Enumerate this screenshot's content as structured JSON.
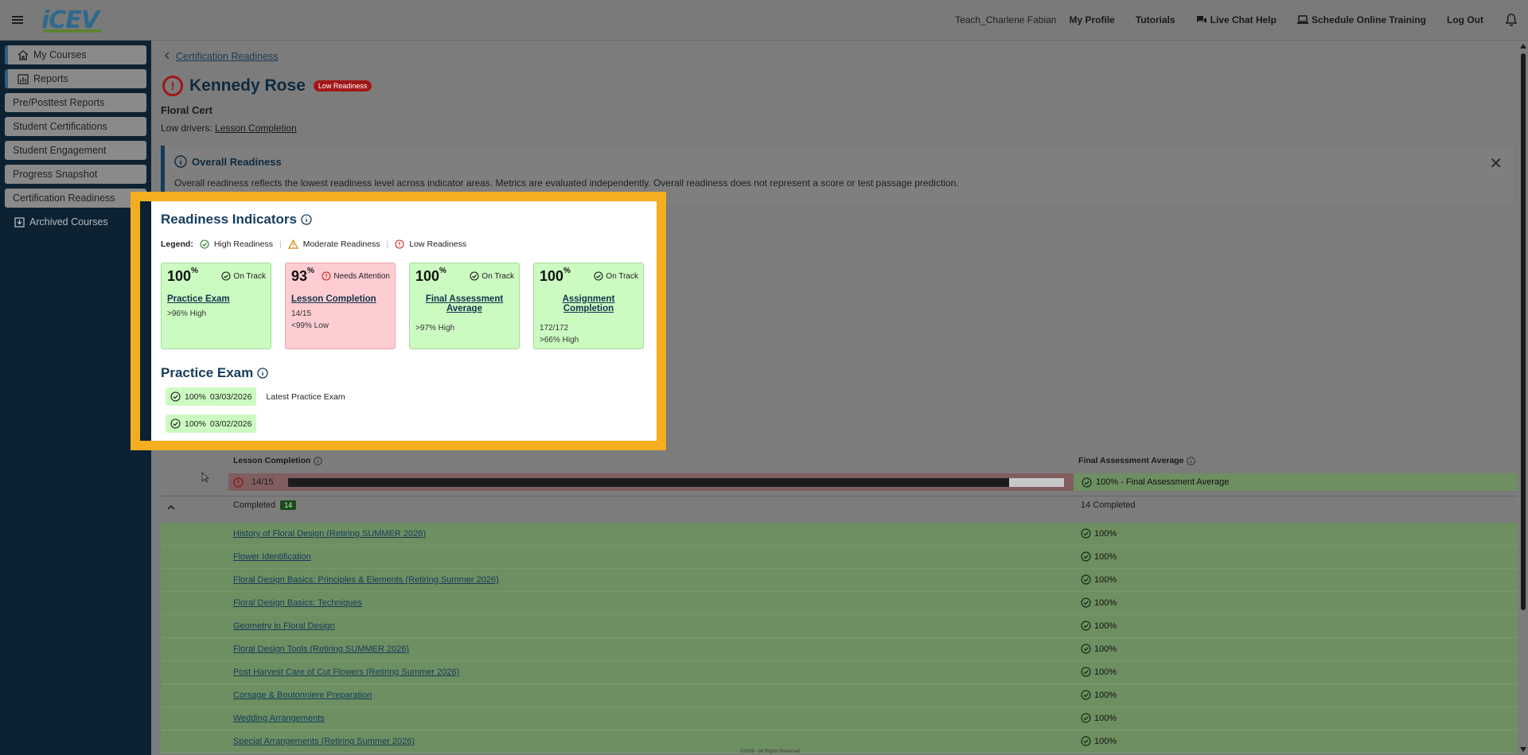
{
  "header": {
    "logo": "iCEV",
    "user": "Teach_Charlene Fabian",
    "links": [
      "My Profile",
      "Tutorials",
      "Live Chat Help",
      "Schedule Online Training",
      "Log Out"
    ]
  },
  "sidebar": {
    "items": [
      {
        "label": "My Courses",
        "icon": "home-icon"
      },
      {
        "label": "Reports",
        "icon": "chart-icon"
      },
      {
        "label": "Pre/Posttest Reports"
      },
      {
        "label": "Student Certifications"
      },
      {
        "label": "Student Engagement"
      },
      {
        "label": "Progress Snapshot"
      },
      {
        "label": "Certification Readiness"
      },
      {
        "label": "Archived Courses",
        "icon": "archive-icon"
      }
    ]
  },
  "breadcrumb": {
    "label": "Certification Readiness"
  },
  "student": {
    "name": "Kennedy Rose",
    "badge": "Low Readiness",
    "cert": "Floral Cert",
    "low_drivers_label": "Low drivers:",
    "low_drivers_value": "Lesson Completion"
  },
  "overall": {
    "title": "Overall Readiness",
    "text": "Overall readiness reflects the lowest readiness level across indicator areas. Metrics are evaluated independently. Overall readiness does not represent a score or test passage prediction."
  },
  "indicators": {
    "title": "Readiness Indicators",
    "legend_label": "Legend:",
    "legend": [
      "High Readiness",
      "Moderate Readiness",
      "Low Readiness"
    ],
    "cards": [
      {
        "pct": "100",
        "sym": "%",
        "status": "On Track",
        "name": "Practice Exam",
        "meta1": ">96% High",
        "meta2": ""
      },
      {
        "pct": "93",
        "sym": "%",
        "status": "Needs Attention",
        "name": "Lesson Completion",
        "meta1": "14/15",
        "meta2": "<99% Low"
      },
      {
        "pct": "100",
        "sym": "%",
        "status": "On Track",
        "name": "Final Assessment Average",
        "meta1": ">97% High",
        "meta2": ""
      },
      {
        "pct": "100",
        "sym": "%",
        "status": "On Track",
        "name": "Assignment Completion",
        "meta1": "172/172",
        "meta2": ">66% High"
      }
    ]
  },
  "practice_exam": {
    "title": "Practice Exam",
    "attempts": [
      {
        "score": "100%",
        "date": "03/03/2026",
        "note": "Latest Practice Exam"
      },
      {
        "score": "100%",
        "date": "03/02/2026",
        "note": ""
      }
    ]
  },
  "table": {
    "col_lesson": "Lesson Completion",
    "col_final": "Final Assessment Average",
    "summary_lesson": "14/15",
    "summary_progress": 0.93,
    "summary_final": "100% - Final Assessment Average",
    "completed_label": "Completed",
    "completed_count": "14",
    "completed_total": "14 Completed",
    "lessons": [
      {
        "name": "History of Floral Design (Retiring SUMMER 2026)",
        "score": "100%"
      },
      {
        "name": "Flower Identification",
        "score": "100%"
      },
      {
        "name": "Floral Design Basics: Principles & Elements (Retiring Summer 2026)",
        "score": "100%"
      },
      {
        "name": "Floral Design Basics: Techniques",
        "score": "100%"
      },
      {
        "name": "Geometry in Floral Design",
        "score": "100%"
      },
      {
        "name": "Floral Design Tools (Retiring SUMMER 2026)",
        "score": "100%"
      },
      {
        "name": "Post Harvest Care of Cut Flowers (Retiring Summer 2026)",
        "score": "100%"
      },
      {
        "name": "Corsage & Boutonniere Preparation",
        "score": "100%"
      },
      {
        "name": "Wedding Arrangements",
        "score": "100%"
      },
      {
        "name": "Special Arrangements (Retiring Summer 2026)",
        "score": "100%"
      }
    ]
  },
  "footer": {
    "text": "©2026 - All Rights Reserved"
  },
  "colors": {
    "accent": "#173d5e",
    "highlight": "#f5ae20",
    "high": "#ccfbc1",
    "low": "#fecdd1",
    "danger": "#a31616"
  }
}
